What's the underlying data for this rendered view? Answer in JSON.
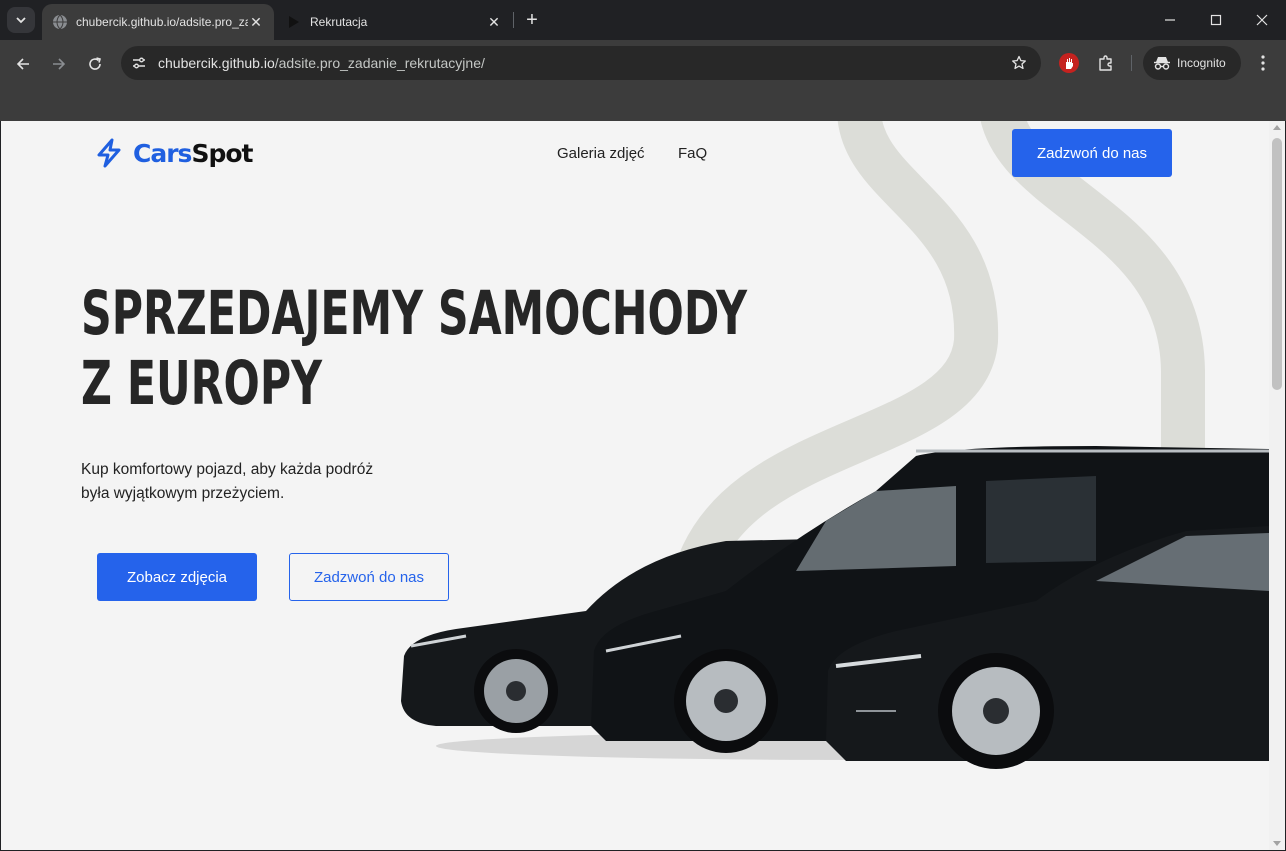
{
  "browser": {
    "tabs": [
      {
        "title": "chubercik.github.io/adsite.pro_zadanie_rekrutacyjne/",
        "active": true
      },
      {
        "title": "Rekrutacja",
        "active": false
      }
    ],
    "url": {
      "host": "chubercik.github.io",
      "path": "/adsite.pro_zadanie_rekrutacyjne/"
    },
    "profile_label": "Incognito"
  },
  "page": {
    "logo": {
      "part1": "Cars",
      "part2": "Spot"
    },
    "nav": [
      {
        "label": "Galeria zdjęć"
      },
      {
        "label": "FaQ"
      }
    ],
    "header_cta": "Zadzwoń do nas",
    "hero": {
      "title_line1": "SPRZEDAJEMY SAMOCHODY",
      "title_line2": "Z EUROPY",
      "subtitle_line1": "Kup komfortowy pojazd, aby każda podróż",
      "subtitle_line2": "była wyjątkowym przeżyciem.",
      "primary_button": "Zobacz zdjęcia",
      "secondary_button": "Zadzwoń do nas"
    }
  },
  "colors": {
    "accent": "#2563eb",
    "page_bg": "#f4f4f4",
    "swirl": "#dcddd8",
    "cars": "#15181b"
  }
}
